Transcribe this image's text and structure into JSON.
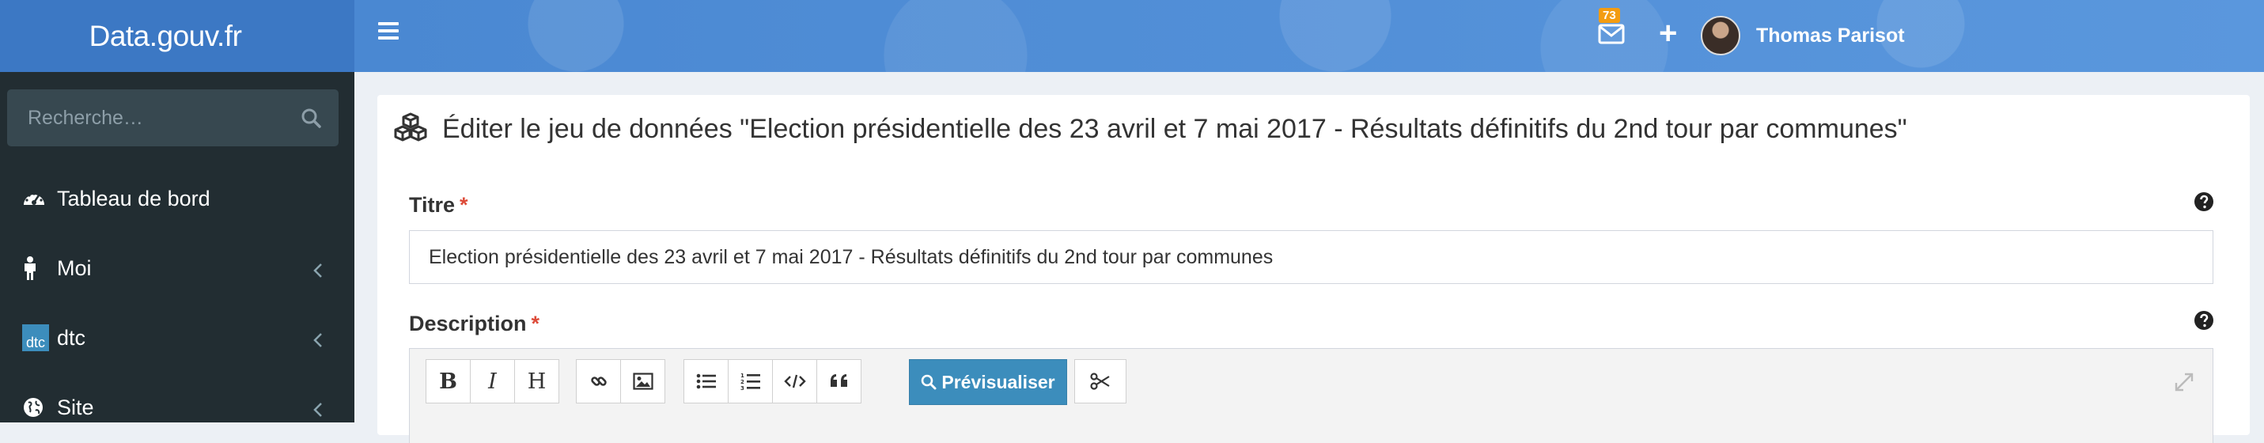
{
  "brand": {
    "name": "Data.gouv.fr"
  },
  "topbar": {
    "menu_icon": "hamburger-icon",
    "mail_badge": "73",
    "mail_icon": "envelope-icon",
    "add_icon": "plus-icon",
    "add_label": "+",
    "user_name": "Thomas Parisot"
  },
  "sidebar": {
    "search_placeholder": "Recherche…",
    "search_icon": "search-icon",
    "items": [
      {
        "label": "Tableau de bord",
        "icon": "dashboard-icon",
        "has_chevron": false
      },
      {
        "label": "Moi",
        "icon": "person-icon",
        "has_chevron": true
      },
      {
        "label": "dtc",
        "icon": "dtc-org-icon",
        "icon_text": "dtc",
        "has_chevron": true
      },
      {
        "label": "Site",
        "icon": "globe-icon",
        "has_chevron": true
      }
    ]
  },
  "page": {
    "header_icon": "cubes-icon",
    "title": "Éditer le jeu de données \"Election présidentielle des 23 avril et 7 mai 2017 - Résultats définitifs du 2nd tour par communes\"",
    "title_field": {
      "label": "Titre",
      "required_mark": "*",
      "value": "Election présidentielle des 23 avril et 7 mai 2017 - Résultats définitifs du 2nd tour par communes"
    },
    "description_field": {
      "label": "Description",
      "required_mark": "*"
    },
    "editor_toolbar": {
      "bold": "B",
      "italic": "I",
      "heading": "H",
      "preview_label": "Prévisualiser"
    }
  },
  "colors": {
    "brand_bg": "#3c78c4",
    "navbar_bg": "#4b8bd6",
    "sidebar_bg": "#222d32",
    "primary_button": "#3c8dbc",
    "badge": "#f39c12",
    "required": "#dd4b39"
  }
}
